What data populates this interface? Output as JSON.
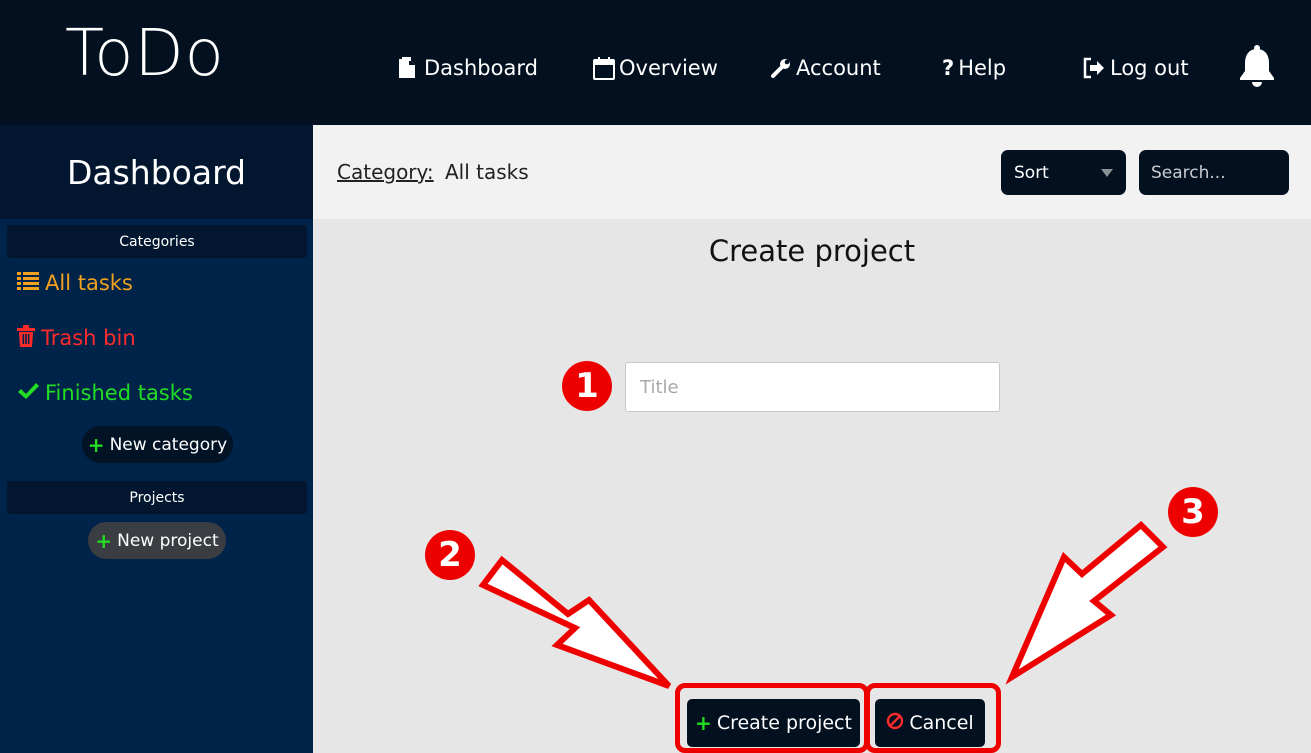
{
  "app": {
    "logo": "ToDo"
  },
  "nav": {
    "dashboard": {
      "label": "Dashboard",
      "icon": "file-icon"
    },
    "overview": {
      "label": "Overview",
      "icon": "calendar-icon"
    },
    "account": {
      "label": "Account",
      "icon": "wrench-icon"
    },
    "help": {
      "label": "Help",
      "icon": "question-icon"
    },
    "logout": {
      "label": "Log out",
      "icon": "logout-icon"
    },
    "notifications": {
      "icon": "bell-icon"
    }
  },
  "sidebar": {
    "title": "Dashboard",
    "categories_header": "Categories",
    "categories": [
      {
        "label": "All tasks",
        "icon": "list-icon",
        "color": "#f0a21f"
      },
      {
        "label": "Trash bin",
        "icon": "trash-icon",
        "color": "#ff2b2b"
      },
      {
        "label": "Finished tasks",
        "icon": "check-icon",
        "color": "#22dd22"
      }
    ],
    "new_category_label": "New category",
    "projects_header": "Projects",
    "new_project_label": "New project"
  },
  "filter": {
    "category_label": "Category:",
    "category_value": "All tasks",
    "sort_label": "Sort",
    "search_placeholder": "Search..."
  },
  "main": {
    "title": "Create project",
    "title_placeholder": "Title",
    "create_label": "Create project",
    "cancel_label": "Cancel"
  },
  "annotations": {
    "badge_1": "1",
    "badge_2": "2",
    "badge_3": "3",
    "color": "#ee0000"
  }
}
